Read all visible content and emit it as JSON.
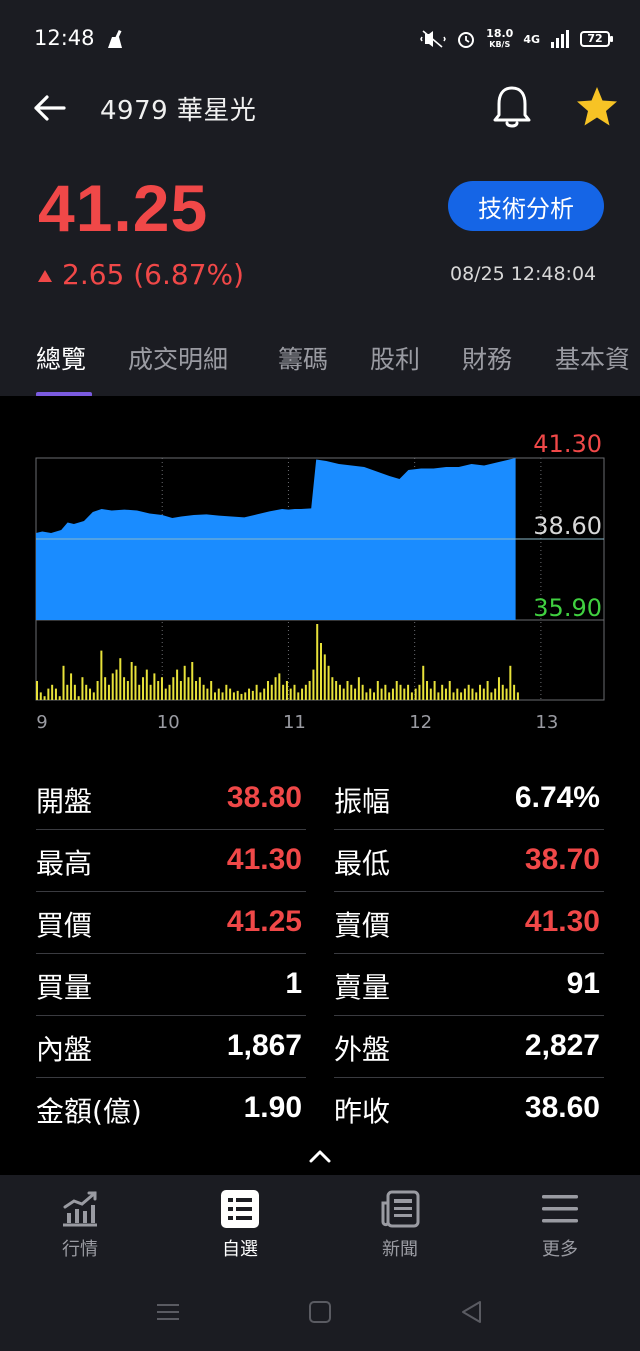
{
  "status_bar": {
    "time": "12:48",
    "net_speed_value": "18.0",
    "net_speed_unit": "KB/S",
    "network_type": "4G",
    "battery": "72"
  },
  "header": {
    "title": "4979 華星光",
    "price": "41.25",
    "change": "2.65 (6.87%)",
    "change_direction": "up",
    "technical_analysis_label": "技術分析",
    "timestamp": "08/25 12:48:04",
    "colors": {
      "up": "#f04848",
      "accent": "#1565e6",
      "star": "#f7c325",
      "tab_indicator": "#7b5be0"
    }
  },
  "tabs": [
    {
      "label": "總覽",
      "active": true
    },
    {
      "label": "成交明細",
      "active": false
    },
    {
      "label": "籌碼",
      "active": false
    },
    {
      "label": "股利",
      "active": false
    },
    {
      "label": "財務",
      "active": false
    },
    {
      "label": "基本資",
      "active": false
    }
  ],
  "chart_data": {
    "type": "area",
    "y_max_label": "41.30",
    "y_ref_label": "38.60",
    "y_min_label": "35.90",
    "ylim": [
      35.9,
      41.3
    ],
    "reference": 38.6,
    "x_tick_labels": [
      "9",
      "10",
      "11",
      "12",
      "13"
    ],
    "x_range_hours": [
      9,
      13.5
    ],
    "grid": true,
    "price_series": [
      [
        9.0,
        38.8
      ],
      [
        9.05,
        38.85
      ],
      [
        9.12,
        38.8
      ],
      [
        9.2,
        38.9
      ],
      [
        9.25,
        39.15
      ],
      [
        9.3,
        39.1
      ],
      [
        9.38,
        39.2
      ],
      [
        9.45,
        39.5
      ],
      [
        9.52,
        39.6
      ],
      [
        9.6,
        39.55
      ],
      [
        9.7,
        39.58
      ],
      [
        9.8,
        39.55
      ],
      [
        9.9,
        39.45
      ],
      [
        10.0,
        39.4
      ],
      [
        10.08,
        39.3
      ],
      [
        10.15,
        39.35
      ],
      [
        10.25,
        39.4
      ],
      [
        10.35,
        39.42
      ],
      [
        10.45,
        39.38
      ],
      [
        10.55,
        39.35
      ],
      [
        10.65,
        39.32
      ],
      [
        10.75,
        39.42
      ],
      [
        10.85,
        39.52
      ],
      [
        10.95,
        39.6
      ],
      [
        11.0,
        39.58
      ],
      [
        11.05,
        39.6
      ],
      [
        11.1,
        39.6
      ],
      [
        11.18,
        39.62
      ],
      [
        11.22,
        41.25
      ],
      [
        11.3,
        41.2
      ],
      [
        11.4,
        41.1
      ],
      [
        11.5,
        41.05
      ],
      [
        11.6,
        41.0
      ],
      [
        11.7,
        40.85
      ],
      [
        11.8,
        40.7
      ],
      [
        11.88,
        40.6
      ],
      [
        11.95,
        40.9
      ],
      [
        12.05,
        40.95
      ],
      [
        12.15,
        40.95
      ],
      [
        12.25,
        41.0
      ],
      [
        12.35,
        41.0
      ],
      [
        12.45,
        41.1
      ],
      [
        12.55,
        41.05
      ],
      [
        12.65,
        41.15
      ],
      [
        12.75,
        41.25
      ],
      [
        12.8,
        41.3
      ]
    ],
    "volume_series": [
      [
        9.0,
        0.25
      ],
      [
        9.03,
        0.1
      ],
      [
        9.06,
        0.05
      ],
      [
        9.09,
        0.15
      ],
      [
        9.12,
        0.2
      ],
      [
        9.15,
        0.15
      ],
      [
        9.18,
        0.05
      ],
      [
        9.21,
        0.45
      ],
      [
        9.24,
        0.2
      ],
      [
        9.27,
        0.35
      ],
      [
        9.3,
        0.2
      ],
      [
        9.33,
        0.05
      ],
      [
        9.36,
        0.3
      ],
      [
        9.39,
        0.2
      ],
      [
        9.42,
        0.15
      ],
      [
        9.45,
        0.1
      ],
      [
        9.48,
        0.25
      ],
      [
        9.51,
        0.65
      ],
      [
        9.54,
        0.3
      ],
      [
        9.57,
        0.2
      ],
      [
        9.6,
        0.35
      ],
      [
        9.63,
        0.4
      ],
      [
        9.66,
        0.55
      ],
      [
        9.69,
        0.3
      ],
      [
        9.72,
        0.25
      ],
      [
        9.75,
        0.5
      ],
      [
        9.78,
        0.45
      ],
      [
        9.81,
        0.2
      ],
      [
        9.84,
        0.3
      ],
      [
        9.87,
        0.4
      ],
      [
        9.9,
        0.2
      ],
      [
        9.93,
        0.35
      ],
      [
        9.96,
        0.25
      ],
      [
        9.99,
        0.3
      ],
      [
        10.02,
        0.15
      ],
      [
        10.05,
        0.2
      ],
      [
        10.08,
        0.3
      ],
      [
        10.11,
        0.4
      ],
      [
        10.14,
        0.25
      ],
      [
        10.17,
        0.45
      ],
      [
        10.2,
        0.3
      ],
      [
        10.23,
        0.5
      ],
      [
        10.26,
        0.25
      ],
      [
        10.29,
        0.3
      ],
      [
        10.32,
        0.2
      ],
      [
        10.35,
        0.15
      ],
      [
        10.38,
        0.25
      ],
      [
        10.41,
        0.1
      ],
      [
        10.44,
        0.15
      ],
      [
        10.47,
        0.1
      ],
      [
        10.5,
        0.2
      ],
      [
        10.53,
        0.15
      ],
      [
        10.56,
        0.1
      ],
      [
        10.59,
        0.12
      ],
      [
        10.62,
        0.08
      ],
      [
        10.65,
        0.1
      ],
      [
        10.68,
        0.15
      ],
      [
        10.71,
        0.12
      ],
      [
        10.74,
        0.2
      ],
      [
        10.77,
        0.1
      ],
      [
        10.8,
        0.15
      ],
      [
        10.83,
        0.25
      ],
      [
        10.86,
        0.2
      ],
      [
        10.89,
        0.3
      ],
      [
        10.92,
        0.35
      ],
      [
        10.95,
        0.2
      ],
      [
        10.98,
        0.25
      ],
      [
        11.01,
        0.15
      ],
      [
        11.04,
        0.2
      ],
      [
        11.07,
        0.1
      ],
      [
        11.1,
        0.15
      ],
      [
        11.13,
        0.2
      ],
      [
        11.16,
        0.25
      ],
      [
        11.19,
        0.4
      ],
      [
        11.22,
        1.0
      ],
      [
        11.25,
        0.75
      ],
      [
        11.28,
        0.6
      ],
      [
        11.31,
        0.45
      ],
      [
        11.34,
        0.3
      ],
      [
        11.37,
        0.25
      ],
      [
        11.4,
        0.2
      ],
      [
        11.43,
        0.15
      ],
      [
        11.46,
        0.25
      ],
      [
        11.49,
        0.2
      ],
      [
        11.52,
        0.15
      ],
      [
        11.55,
        0.3
      ],
      [
        11.58,
        0.2
      ],
      [
        11.61,
        0.1
      ],
      [
        11.64,
        0.15
      ],
      [
        11.67,
        0.1
      ],
      [
        11.7,
        0.25
      ],
      [
        11.73,
        0.15
      ],
      [
        11.76,
        0.2
      ],
      [
        11.79,
        0.1
      ],
      [
        11.82,
        0.15
      ],
      [
        11.85,
        0.25
      ],
      [
        11.88,
        0.2
      ],
      [
        11.91,
        0.15
      ],
      [
        11.94,
        0.2
      ],
      [
        11.97,
        0.1
      ],
      [
        12.0,
        0.15
      ],
      [
        12.03,
        0.2
      ],
      [
        12.06,
        0.45
      ],
      [
        12.09,
        0.25
      ],
      [
        12.12,
        0.15
      ],
      [
        12.15,
        0.25
      ],
      [
        12.18,
        0.1
      ],
      [
        12.21,
        0.2
      ],
      [
        12.24,
        0.15
      ],
      [
        12.27,
        0.25
      ],
      [
        12.3,
        0.1
      ],
      [
        12.33,
        0.15
      ],
      [
        12.36,
        0.1
      ],
      [
        12.39,
        0.15
      ],
      [
        12.42,
        0.2
      ],
      [
        12.45,
        0.15
      ],
      [
        12.48,
        0.1
      ],
      [
        12.51,
        0.2
      ],
      [
        12.54,
        0.15
      ],
      [
        12.57,
        0.25
      ],
      [
        12.6,
        0.1
      ],
      [
        12.63,
        0.15
      ],
      [
        12.66,
        0.3
      ],
      [
        12.69,
        0.2
      ],
      [
        12.72,
        0.15
      ],
      [
        12.75,
        0.45
      ],
      [
        12.78,
        0.2
      ],
      [
        12.81,
        0.1
      ]
    ],
    "colors": {
      "area": "#1a8cff",
      "volume": "#e8e23a",
      "max_label": "#f04848",
      "ref_label": "#d8d8d8",
      "min_label": "#40d040"
    }
  },
  "stats": [
    {
      "label": "開盤",
      "value": "38.80",
      "color": "red"
    },
    {
      "label": "振幅",
      "value": "6.74%",
      "color": "white"
    },
    {
      "label": "最高",
      "value": "41.30",
      "color": "red"
    },
    {
      "label": "最低",
      "value": "38.70",
      "color": "red"
    },
    {
      "label": "買價",
      "value": "41.25",
      "color": "red"
    },
    {
      "label": "賣價",
      "value": "41.30",
      "color": "red"
    },
    {
      "label": "買量",
      "value": "1",
      "color": "white"
    },
    {
      "label": "賣量",
      "value": "91",
      "color": "white"
    },
    {
      "label": "內盤",
      "value": "1,867",
      "color": "white"
    },
    {
      "label": "外盤",
      "value": "2,827",
      "color": "white"
    },
    {
      "label": "金額(億)",
      "value": "1.90",
      "color": "white"
    },
    {
      "label": "昨收",
      "value": "38.60",
      "color": "white"
    }
  ],
  "bottom_nav": [
    {
      "label": "行情",
      "icon": "market-chart-icon",
      "active": false
    },
    {
      "label": "自選",
      "icon": "watchlist-icon",
      "active": true
    },
    {
      "label": "新聞",
      "icon": "news-icon",
      "active": false
    },
    {
      "label": "更多",
      "icon": "menu-icon",
      "active": false
    }
  ]
}
